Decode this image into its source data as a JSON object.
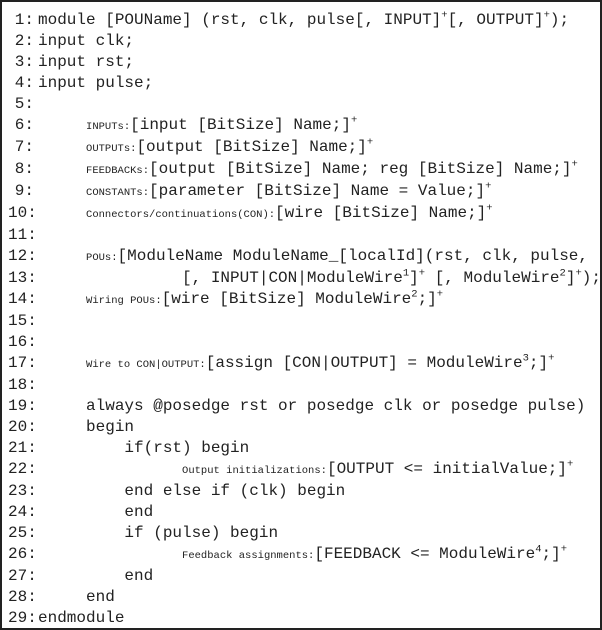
{
  "lines": {
    "1": {
      "t": "module [POUName] (rst, clk, pulse[, INPUT]",
      "sup1": "+",
      "t2": "[, OUTPUT]",
      "sup2": "+",
      "t3": ");"
    },
    "2": {
      "t": "     input clk;"
    },
    "3": {
      "t": "     input rst;"
    },
    "4": {
      "t": "     input pulse;"
    },
    "5": {
      "t": ""
    },
    "6": {
      "pad": "     ",
      "lbl": "INPUTs:",
      "t": "[input [BitSize] Name;]",
      "sup": "+"
    },
    "7": {
      "pad": "     ",
      "lbl": "OUTPUTs:",
      "t": "[output [BitSize] Name;]",
      "sup": "+"
    },
    "8": {
      "pad": "     ",
      "lbl": "FEEDBACKs:",
      "t": "[output [BitSize] Name; reg [BitSize] Name;]",
      "sup": "+"
    },
    "9": {
      "pad": "     ",
      "lbl": "CONSTANTs:",
      "t": "[parameter [BitSize] Name = Value;]",
      "sup": "+"
    },
    "10": {
      "pad": "     ",
      "lbl": "Connectors/continuations(CON):",
      "t": "[wire [BitSize] Name;]",
      "sup": "+"
    },
    "11": {
      "t": ""
    },
    "12": {
      "pad": "     ",
      "lbl": "POUs:",
      "t": "[ModuleName ModuleName_[localId](rst, clk, pulse,"
    },
    "13": {
      "t": "               [, INPUT|CON|ModuleWire",
      "sup1": "1",
      "t2": "]",
      "sup2": "+",
      "t3": " [, ModuleWire",
      "sup3": "2",
      "t4": "]",
      "sup4": "+",
      "t5": ");]",
      "sup5": "+"
    },
    "14": {
      "pad": "     ",
      "lbl": "Wiring POUs:",
      "t": "[wire [BitSize] ModuleWire",
      "sup1": "2",
      "t2": ";]",
      "sup2": "+"
    },
    "15": {
      "t": ""
    },
    "16": {
      "t": ""
    },
    "17": {
      "pad": "     ",
      "lbl": "Wire to CON|OUTPUT:",
      "t": "[assign [CON|OUTPUT] = ModuleWire",
      "sup1": "3",
      "t2": ";]",
      "sup2": "+"
    },
    "18": {
      "t": ""
    },
    "19": {
      "t": "     always @posedge rst or posedge clk or posedge pulse)"
    },
    "20": {
      "t": "     begin"
    },
    "21": {
      "t": "         if(rst) begin"
    },
    "22": {
      "pad": "               ",
      "lbl": "Output initializations:",
      "t": "[OUTPUT <= initialValue;]",
      "sup": "+"
    },
    "23": {
      "t": "         end else if (clk) begin"
    },
    "24": {
      "t": "         end"
    },
    "25": {
      "t": "         if (pulse) begin"
    },
    "26": {
      "pad": "               ",
      "lbl": "Feedback assignments:",
      "t": "[FEEDBACK <= ModuleWire",
      "sup1": "4",
      "t2": ";]",
      "sup2": "+"
    },
    "27": {
      "t": "         end"
    },
    "28": {
      "t": "     end"
    },
    "29": {
      "t": "endmodule"
    }
  }
}
